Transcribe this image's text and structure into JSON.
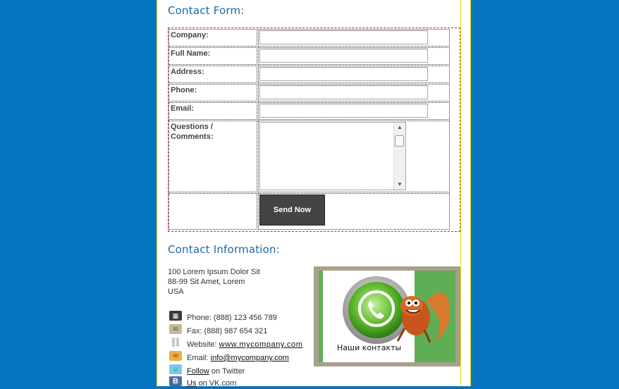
{
  "headings": {
    "contact_form": "Contact Form:",
    "contact_info": "Contact Information:"
  },
  "form": {
    "fields": [
      {
        "label": "Company:",
        "value": ""
      },
      {
        "label": "Full Name:",
        "value": ""
      },
      {
        "label": "Address:",
        "value": ""
      },
      {
        "label": "Phone:",
        "value": ""
      },
      {
        "label": "Email:",
        "value": ""
      }
    ],
    "comments_label_line1": "Questions /",
    "comments_label_line2": "Comments:",
    "submit_label": "Send Now"
  },
  "address": {
    "line1": "100 Lorem Ipsum Dolor Sit",
    "line2": "88-99 Sit Amet, Lorem",
    "line3": "USA"
  },
  "contacts": {
    "phone": "Phone: (888) 123 456 789",
    "fax": "Fax: (888) 987 654 321",
    "website_prefix": "Website:",
    "website_link": "www.mycompany.com",
    "email_prefix": "Email:",
    "email_link": "info@mycompany.com",
    "twitter_link": "Follow",
    "twitter_suffix": "on Twitter",
    "vk_link": "Us",
    "vk_suffix": "on VK.com"
  },
  "image": {
    "caption": "Наши контакты"
  },
  "colors": {
    "background": "#0474c0",
    "heading": "#1e67a8",
    "button": "#444444",
    "guide_border": "#e8e000",
    "form_border": "#c83030"
  },
  "icons": [
    "calculator-icon",
    "fax-icon",
    "link-icon",
    "email-icon",
    "twitter-icon",
    "vk-icon",
    "phone-icon"
  ]
}
